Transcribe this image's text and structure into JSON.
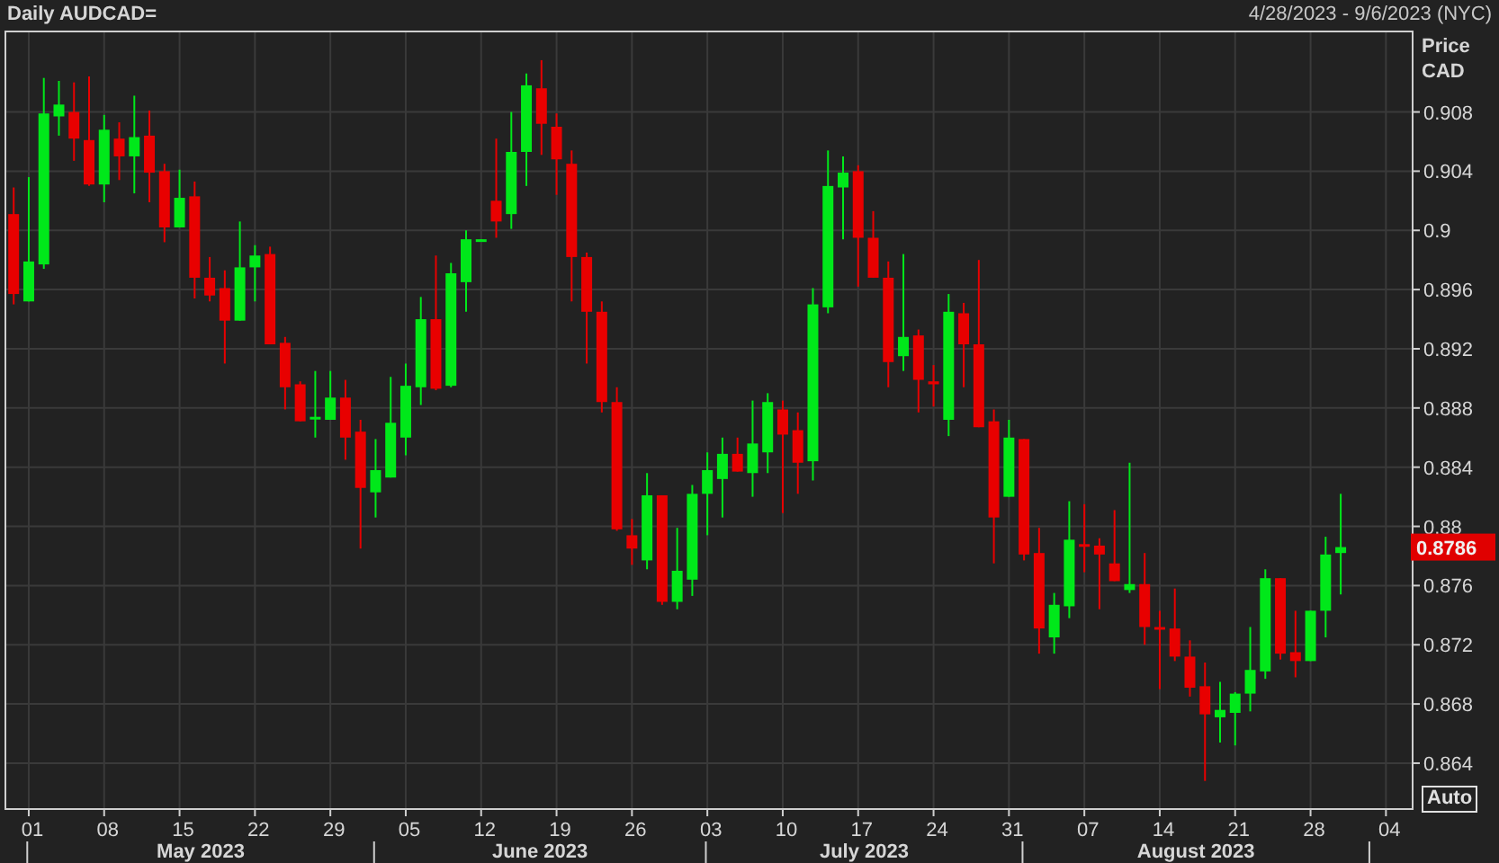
{
  "header": {
    "title": "Daily AUDCAD=",
    "range": "4/28/2023 - 9/6/2023 (NYC)"
  },
  "chart": {
    "axis_header": [
      "Price",
      "CAD"
    ],
    "last_price": "0.8786",
    "auto_button": "Auto",
    "months": [
      "May 2023",
      "June 2023",
      "July 2023",
      "August 2023"
    ],
    "chart_data": {
      "type": "candlestick",
      "grid": true,
      "categories": [
        null,
        "01",
        null,
        null,
        null,
        null,
        "08",
        null,
        null,
        null,
        null,
        "15",
        null,
        null,
        null,
        null,
        "22",
        null,
        null,
        null,
        null,
        "29",
        null,
        null,
        null,
        null,
        "05",
        null,
        null,
        null,
        null,
        "12",
        null,
        null,
        null,
        null,
        "19",
        null,
        null,
        null,
        null,
        "26",
        null,
        null,
        null,
        null,
        "03",
        null,
        null,
        null,
        null,
        "10",
        null,
        null,
        null,
        null,
        "17",
        null,
        null,
        null,
        null,
        "24",
        null,
        null,
        null,
        null,
        "31",
        null,
        null,
        null,
        null,
        "07",
        null,
        null,
        null,
        null,
        "14",
        null,
        null,
        null,
        null,
        "21",
        null,
        null,
        null,
        null,
        "28",
        null,
        null,
        null,
        null,
        "04"
      ],
      "ohlc": [
        [
          0.9011,
          0.9029,
          0.895,
          0.8957
        ],
        [
          0.8952,
          0.9036,
          0.8952,
          0.8979
        ],
        [
          0.8977,
          0.9103,
          0.8974,
          0.9079
        ],
        [
          0.9077,
          0.9101,
          0.9064,
          0.9085
        ],
        [
          0.908,
          0.91,
          0.9047,
          0.9062
        ],
        [
          0.9061,
          0.9104,
          0.903,
          0.9031
        ],
        [
          0.9031,
          0.9078,
          0.9019,
          0.9068
        ],
        [
          0.9062,
          0.9073,
          0.9034,
          0.905
        ],
        [
          0.905,
          0.9091,
          0.9025,
          0.9063
        ],
        [
          0.9064,
          0.9081,
          0.9019,
          0.9039
        ],
        [
          0.904,
          0.9045,
          0.8992,
          0.9002
        ],
        [
          0.9002,
          0.9041,
          0.9002,
          0.9022
        ],
        [
          0.9023,
          0.9033,
          0.8954,
          0.8968
        ],
        [
          0.8968,
          0.8982,
          0.8952,
          0.8956
        ],
        [
          0.8961,
          0.8973,
          0.891,
          0.8939
        ],
        [
          0.8939,
          0.9006,
          0.8939,
          0.8975
        ],
        [
          0.8975,
          0.899,
          0.8952,
          0.8983
        ],
        [
          0.8984,
          0.8989,
          0.8923,
          0.8923
        ],
        [
          0.8924,
          0.8928,
          0.8879,
          0.8894
        ],
        [
          0.8896,
          0.8898,
          0.8871,
          0.8871
        ],
        [
          0.8873,
          0.8905,
          0.886,
          0.8874
        ],
        [
          0.8872,
          0.8905,
          0.8872,
          0.8887
        ],
        [
          0.8887,
          0.8899,
          0.8845,
          0.886
        ],
        [
          0.8864,
          0.8872,
          0.8785,
          0.8826
        ],
        [
          0.8823,
          0.8859,
          0.8806,
          0.8838
        ],
        [
          0.8833,
          0.8901,
          0.8833,
          0.887
        ],
        [
          0.886,
          0.891,
          0.8848,
          0.8895
        ],
        [
          0.8894,
          0.8955,
          0.8882,
          0.894
        ],
        [
          0.894,
          0.8983,
          0.8892,
          0.8893
        ],
        [
          0.8895,
          0.8978,
          0.8894,
          0.8971
        ],
        [
          0.8965,
          0.9,
          0.8945,
          0.8994
        ],
        [
          0.8994,
          0.8994,
          0.8994,
          0.8994
        ],
        [
          0.902,
          0.9062,
          0.8995,
          0.9006
        ],
        [
          0.9011,
          0.908,
          0.9001,
          0.9053
        ],
        [
          0.9053,
          0.9106,
          0.903,
          0.9098
        ],
        [
          0.9096,
          0.9115,
          0.9051,
          0.9072
        ],
        [
          0.907,
          0.9079,
          0.9024,
          0.9048
        ],
        [
          0.9045,
          0.9054,
          0.8952,
          0.8982
        ],
        [
          0.8982,
          0.8985,
          0.891,
          0.8945
        ],
        [
          0.8945,
          0.8952,
          0.8877,
          0.8884
        ],
        [
          0.8884,
          0.8894,
          0.8797,
          0.8798
        ],
        [
          0.8794,
          0.8805,
          0.8774,
          0.8785
        ],
        [
          0.8777,
          0.8836,
          0.8771,
          0.8821
        ],
        [
          0.8821,
          0.8821,
          0.8747,
          0.8749
        ],
        [
          0.8749,
          0.8799,
          0.8744,
          0.877
        ],
        [
          0.8764,
          0.8828,
          0.8753,
          0.8822
        ],
        [
          0.8822,
          0.885,
          0.8794,
          0.8838
        ],
        [
          0.8832,
          0.886,
          0.8806,
          0.8849
        ],
        [
          0.8849,
          0.886,
          0.8837,
          0.8837
        ],
        [
          0.8836,
          0.8885,
          0.882,
          0.8856
        ],
        [
          0.885,
          0.889,
          0.8836,
          0.8884
        ],
        [
          0.8879,
          0.8885,
          0.8809,
          0.8862
        ],
        [
          0.8865,
          0.8877,
          0.8822,
          0.8843
        ],
        [
          0.8844,
          0.8961,
          0.8831,
          0.895
        ],
        [
          0.8948,
          0.9054,
          0.8944,
          0.903
        ],
        [
          0.9029,
          0.905,
          0.8994,
          0.9039
        ],
        [
          0.904,
          0.9044,
          0.8962,
          0.8995
        ],
        [
          0.8995,
          0.9013,
          0.8968,
          0.8968
        ],
        [
          0.8968,
          0.8979,
          0.8894,
          0.8911
        ],
        [
          0.8915,
          0.8984,
          0.8905,
          0.8928
        ],
        [
          0.8929,
          0.8933,
          0.8877,
          0.8899
        ],
        [
          0.8898,
          0.8909,
          0.8881,
          0.8896
        ],
        [
          0.8872,
          0.8957,
          0.8861,
          0.8945
        ],
        [
          0.8944,
          0.8951,
          0.8894,
          0.8923
        ],
        [
          0.8923,
          0.898,
          0.8867,
          0.8867
        ],
        [
          0.8871,
          0.8879,
          0.8775,
          0.8806
        ],
        [
          0.882,
          0.8872,
          0.882,
          0.886
        ],
        [
          0.8859,
          0.8859,
          0.8777,
          0.8781
        ],
        [
          0.8782,
          0.8799,
          0.8714,
          0.8731
        ],
        [
          0.8725,
          0.8755,
          0.8714,
          0.8747
        ],
        [
          0.8746,
          0.8817,
          0.8738,
          0.8791
        ],
        [
          0.8788,
          0.8815,
          0.8769,
          0.8787
        ],
        [
          0.8787,
          0.8792,
          0.8744,
          0.8781
        ],
        [
          0.8775,
          0.8811,
          0.8763,
          0.8763
        ],
        [
          0.8757,
          0.8843,
          0.8755,
          0.8761
        ],
        [
          0.8761,
          0.8782,
          0.872,
          0.8732
        ],
        [
          0.8732,
          0.8743,
          0.869,
          0.8731
        ],
        [
          0.8731,
          0.8758,
          0.8709,
          0.8712
        ],
        [
          0.8712,
          0.8723,
          0.8685,
          0.8691
        ],
        [
          0.8692,
          0.8708,
          0.8628,
          0.8673
        ],
        [
          0.8671,
          0.8695,
          0.8654,
          0.8676
        ],
        [
          0.8674,
          0.8688,
          0.8652,
          0.8687
        ],
        [
          0.8687,
          0.8732,
          0.8675,
          0.8703
        ],
        [
          0.8702,
          0.8771,
          0.8697,
          0.8765
        ],
        [
          0.8765,
          0.8765,
          0.871,
          0.8714
        ],
        [
          0.8715,
          0.8743,
          0.8698,
          0.8709
        ],
        [
          0.8709,
          0.8743,
          0.8709,
          0.8743
        ],
        [
          0.8743,
          0.8793,
          0.8725,
          0.8781
        ],
        [
          0.8782,
          0.8822,
          0.8754,
          0.8786
        ],
        null,
        null,
        null
      ],
      "ylim": [
        0.8609,
        0.9135
      ],
      "yticks": [
        0.864,
        0.868,
        0.872,
        0.876,
        0.88,
        0.884,
        0.888,
        0.892,
        0.896,
        0.9,
        0.904,
        0.908
      ]
    }
  }
}
